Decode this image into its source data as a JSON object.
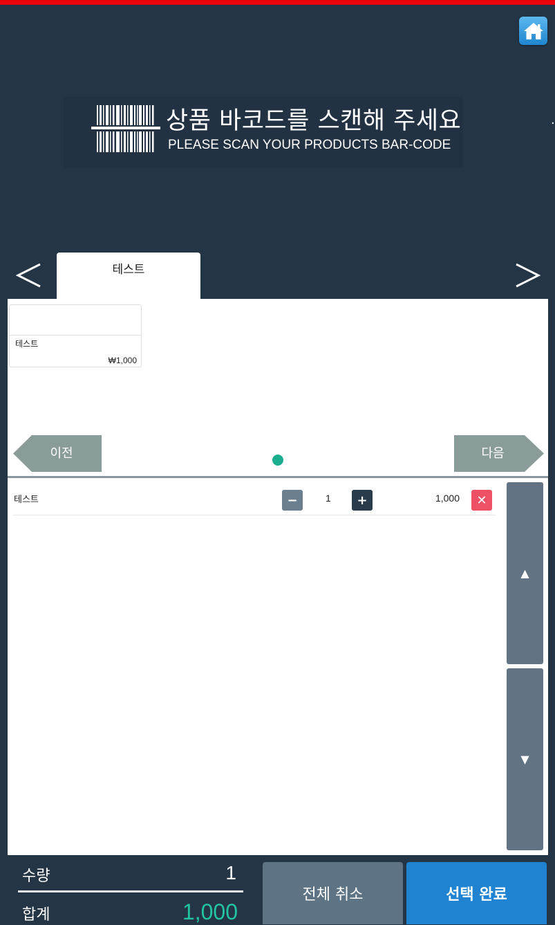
{
  "header": {
    "home_icon": "home-icon",
    "scan_title_ko": "상품 바코드를 스캔해 주세요",
    "scan_title_en": "PLEASE SCAN YOUR PRODUCTS BAR-CODE",
    "edge_marker": "·"
  },
  "categories": {
    "prev_icon": "chevron-left-icon",
    "next_icon": "chevron-right-icon",
    "tabs": [
      {
        "label": "테스트",
        "active": true
      }
    ]
  },
  "products": [
    {
      "name": "테스트",
      "price": "₩1,000"
    }
  ],
  "pager": {
    "prev_label": "이전",
    "next_label": "다음",
    "pages": 1,
    "current": 1
  },
  "cart": {
    "items": [
      {
        "name": "테스트",
        "qty": "1",
        "total": "1,000"
      }
    ],
    "minus_symbol": "−",
    "plus_symbol": "+",
    "remove_symbol": "✕",
    "scroll_up_symbol": "▲",
    "scroll_down_symbol": "▼"
  },
  "summary": {
    "qty_label": "수량",
    "qty_value": "1",
    "total_label": "합계",
    "total_value": "1,000"
  },
  "actions": {
    "cancel_all": "전체 취소",
    "complete": "선택 완료"
  },
  "colors": {
    "background": "#243545",
    "top_bar": "#e8000b",
    "accent_teal": "#1aae8f",
    "total_teal": "#23c4a0",
    "complete_blue": "#1f83d2",
    "cancel_gray": "#5e7484",
    "remove_red": "#ee5166"
  }
}
